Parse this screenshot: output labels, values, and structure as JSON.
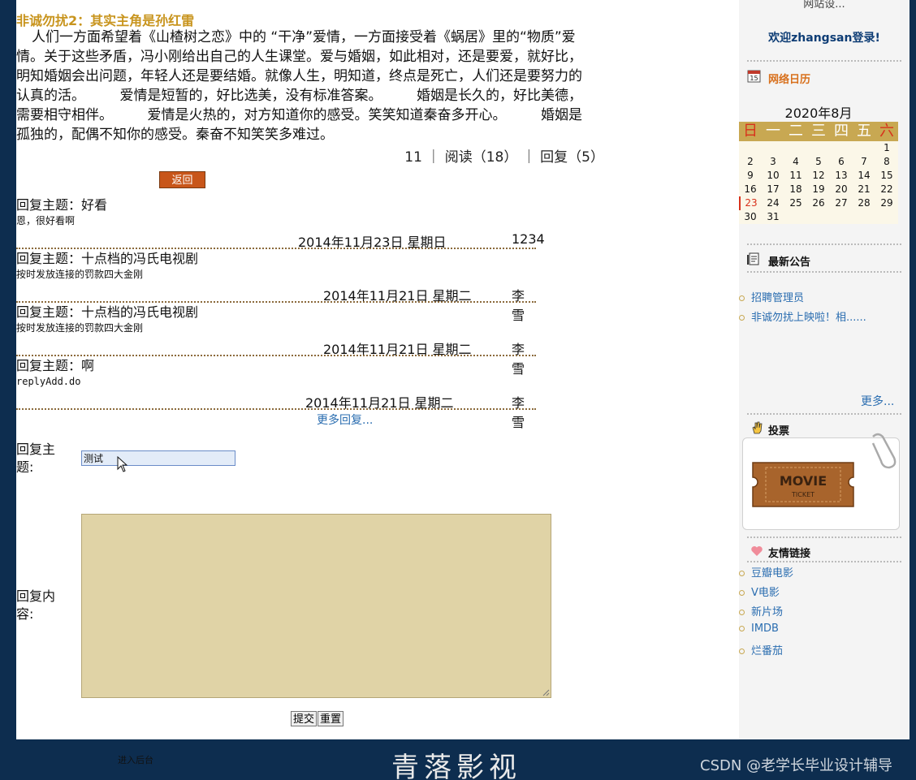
{
  "article": {
    "title": "非诚勿扰2：其实主角是孙红雷",
    "body": "人们一方面希望着《山楂树之恋》中的 “干净”爱情，一方面接受着《蜗居》里的“物质”爱情。关于这些矛盾，冯小刚给出自己的人生课堂。爱与婚姻，如此相对，还是要爱，就好比，明知婚姻会出问题，年轻人还是要结婚。就像人生，明知道，终点是死亡，人们还是要努力的认真的活。　　　爱情是短暂的，好比选美，没有标准答案。　　　婚姻是长久的，好比美德，需要相守相伴。　　　爱情是火热的，对方知道你的感受。笑笑知道秦奋多开心。　　　婚姻是孤独的，配偶不知你的感受。秦奋不知笑笑多难过。",
    "stats": "11 ｜ 阅读（18） ｜ 回复（5）",
    "back_label": "返回"
  },
  "replies": [
    {
      "title": "回复主题：好看",
      "content": "恩，很好看啊",
      "date": "2014年11月23日 星期日",
      "author": "1234"
    },
    {
      "title": "回复主题：十点档的冯氏电视剧",
      "content": "按时发放连接的罚款四大金刚",
      "date": "2014年11月21日 星期二",
      "author": "李雪"
    },
    {
      "title": "回复主题：十点档的冯氏电视剧",
      "content": "按时发放连接的罚款四大金刚",
      "date": "2014年11月21日 星期二",
      "author": "李雪"
    },
    {
      "title": "回复主题：啊",
      "content": "replyAdd.do",
      "date": "2014年11月21日 星期二",
      "author": "李雪"
    }
  ],
  "more_replies": "更多回复...",
  "form": {
    "subject_label": "回复主题:",
    "subject_value": "测试",
    "content_label": "回复内容:",
    "submit_label": "提交",
    "reset_label": "重置"
  },
  "sidebar": {
    "top_text": "网站设...",
    "welcome": "欢迎zhangsan登录!",
    "calendar_heading": "网络日历",
    "calendar_icon_num": "15",
    "calendar": {
      "title": "2020年8月",
      "weekdays": [
        "日",
        "一",
        "二",
        "三",
        "四",
        "五",
        "六"
      ],
      "weeks": [
        [
          "",
          "",
          "",
          "",
          "",
          "",
          "1"
        ],
        [
          "2",
          "3",
          "4",
          "5",
          "6",
          "7",
          "8"
        ],
        [
          "9",
          "10",
          "11",
          "12",
          "13",
          "14",
          "15"
        ],
        [
          "16",
          "17",
          "18",
          "19",
          "20",
          "21",
          "22"
        ],
        [
          "23",
          "24",
          "25",
          "26",
          "27",
          "28",
          "29"
        ],
        [
          "30",
          "31",
          "",
          "",
          "",
          "",
          ""
        ]
      ],
      "today": "23"
    },
    "notice_heading": "最新公告",
    "notices": [
      "招聘管理员",
      "非诚勿扰上映啦！相......"
    ],
    "more_label": "更多...",
    "vote_heading": "投票",
    "ticket": {
      "line1": "MOVIE",
      "line2": "TICKET"
    },
    "links_heading": "友情链接",
    "links": [
      "豆瓣电影",
      "V电影",
      "新片场",
      "IMDB",
      "烂番茄"
    ]
  },
  "footer": {
    "admin_label": "进入后台",
    "brand": "青落影视",
    "watermark": "CSDN @老学长毕业设计辅导"
  },
  "colors": {
    "frame": "#0d2d4f",
    "accent_gold": "#c8941d",
    "back_button": "#c8561a",
    "calendar_header": "#c8a852",
    "textarea_bg": "#e0d3a6",
    "link_blue": "#2a6db0",
    "welcome_blue": "#0e3d75"
  }
}
